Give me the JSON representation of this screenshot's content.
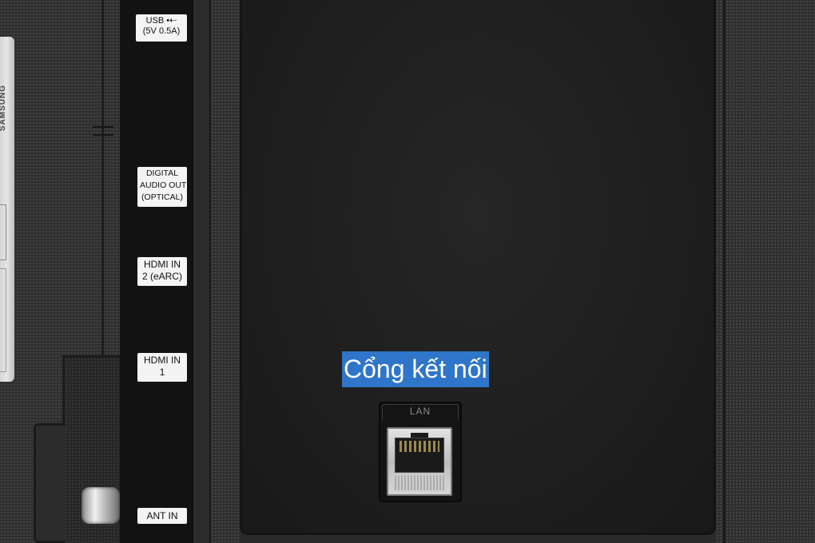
{
  "caption": "Cổng kết nối",
  "ports": {
    "usb": [
      "USB •⇠",
      "(5V 0.5A)"
    ],
    "optical": [
      "DIGITAL",
      "AUDIO OUT",
      "(OPTICAL)"
    ],
    "hdmi2": [
      "HDMI IN",
      "2 (eARC)"
    ],
    "hdmi1": [
      "HDMI IN",
      "1"
    ],
    "ant": "ANT IN",
    "lan": "LAN"
  },
  "sticker_brand": "SAMSUNG",
  "colors": {
    "caption_bg": "#2f75c9",
    "caption_text": "#ffffff",
    "panel": "#1e1e1e",
    "label_bg": "#f4f4f4"
  }
}
